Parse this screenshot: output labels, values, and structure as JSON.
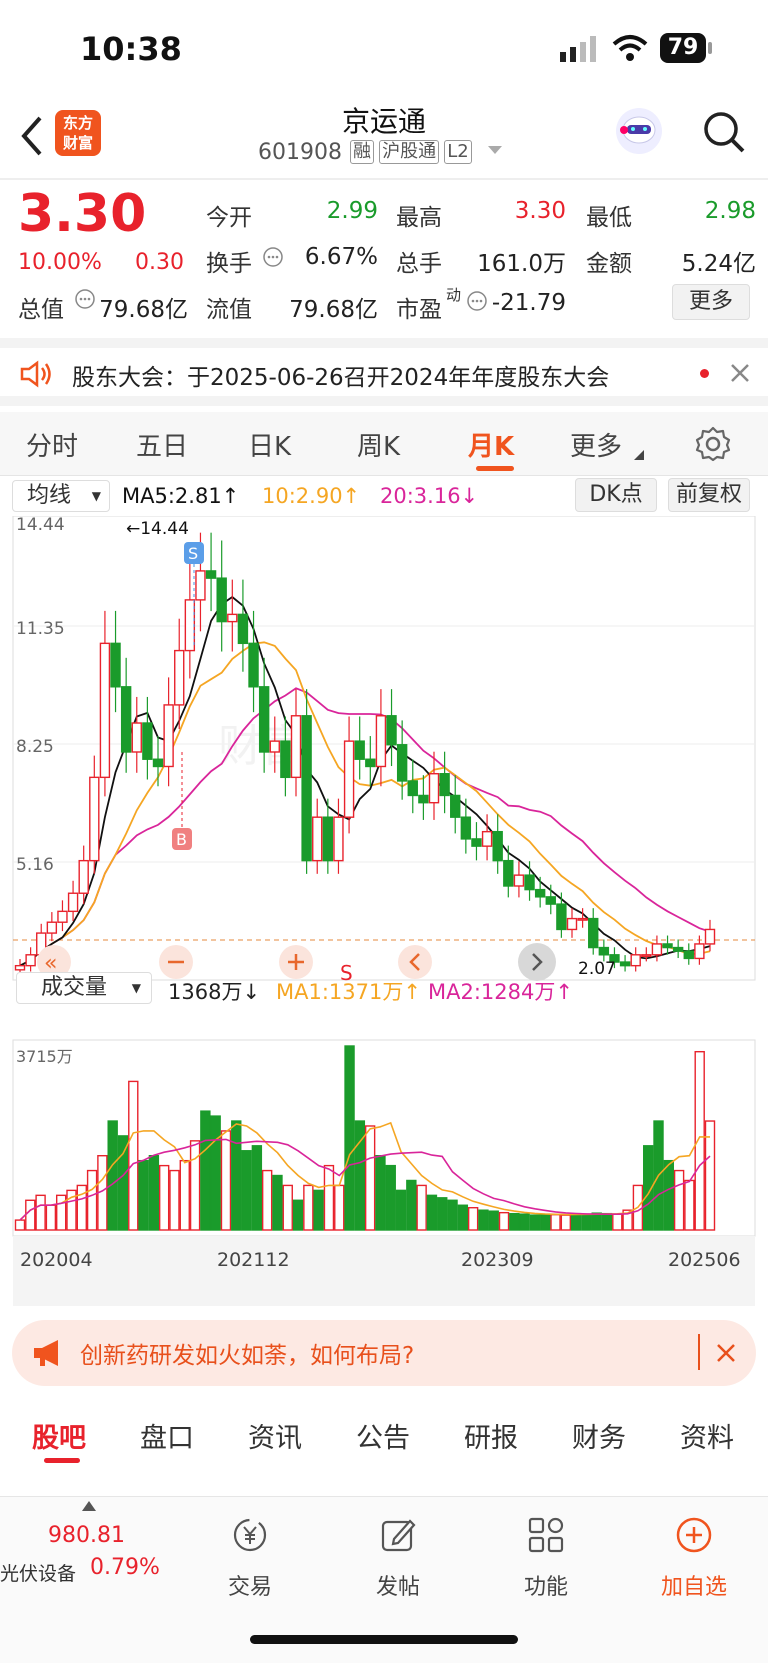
{
  "status": {
    "time": "10:38",
    "battery": "79"
  },
  "header": {
    "logo": "东方\n财富",
    "name": "京运通",
    "code": "601908",
    "tags": [
      "融",
      "沪股通",
      "L2"
    ]
  },
  "quote": {
    "price": "3.30",
    "pct": "10.00%",
    "chg": "0.30",
    "open_label": "今开",
    "open": "2.99",
    "high_label": "最高",
    "high": "3.30",
    "low_label": "最低",
    "low": "2.98",
    "turnover_label": "换手",
    "turnover": "6.67%",
    "vol_label": "总手",
    "vol": "161.0万",
    "amt_label": "金额",
    "amt": "5.24亿",
    "mcap_label": "总值",
    "mcap": "79.68亿",
    "float_label": "流值",
    "float": "79.68亿",
    "pe_label": "市盈",
    "pe_sup": "动",
    "pe": "-21.79",
    "more": "更多"
  },
  "notice": {
    "text": "股东大会：于2025-06-26召开2024年年度股东大会"
  },
  "ktabs": {
    "items": [
      "分时",
      "五日",
      "日K",
      "周K",
      "月K",
      "更多"
    ],
    "active": 4
  },
  "chart": {
    "indicator": "均线",
    "ma5": "MA5:2.81↑",
    "ma10": "10:2.90↑",
    "ma20": "20:3.16↓",
    "dk": "DK点",
    "fq": "前复权",
    "price_ticks": [
      "14.44",
      "11.35",
      "8.25",
      "5.16",
      "2.07"
    ],
    "max_label": "←14.44",
    "min_label": "2.07",
    "watermark": "财富",
    "vol_indicator": "成交量",
    "vol_now": "1368万↓",
    "vol_ma1": "MA1:1371万↑",
    "vol_ma2": "MA2:1284万↑",
    "vol_max": "3715万",
    "dates": [
      "202004",
      "202112",
      "202309",
      "202506"
    ],
    "marker_s": "S",
    "marker_b": "B",
    "ctrl_s": "S",
    "colors": {
      "up": "#e8222c",
      "down": "#1a9b2b",
      "ma5": "#111111",
      "ma10": "#f5a623",
      "ma20": "#d9259a"
    }
  },
  "chart_data": {
    "type": "candlestick",
    "price_range": [
      2.07,
      14.44
    ],
    "volume_range": [
      0,
      3715
    ],
    "volume_unit": "万",
    "x_labels": [
      "202004",
      "202112",
      "202309",
      "202506"
    ]
  },
  "banner": {
    "text": "创新药研发如火如荼，如何布局?"
  },
  "subtabs": {
    "items": [
      "股吧",
      "盘口",
      "资讯",
      "公告",
      "研报",
      "财务",
      "资料"
    ],
    "active": 0
  },
  "bottom": {
    "index_val": "980.81",
    "index_name": "光伏设备",
    "index_pct": "0.79%",
    "items": [
      "交易",
      "发帖",
      "功能",
      "加自选"
    ]
  }
}
